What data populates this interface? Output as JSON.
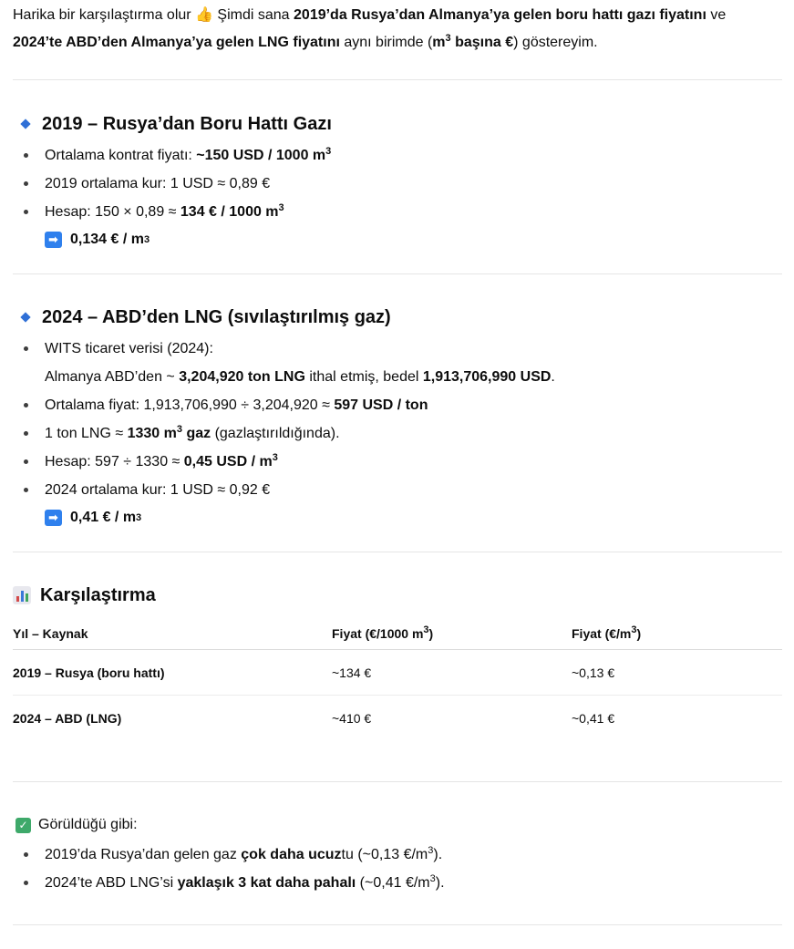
{
  "intro": {
    "t1": "Harika bir karşılaştırma olur ",
    "emoji": "👍",
    "t2": " Şimdi sana ",
    "b1": "2019’da Rusya’dan Almanya’ya gelen boru hattı gazı fiyatını",
    "t3": " ve",
    "b2": "2024’te ABD’den Almanya’ya gelen LNG fiyatını",
    "t4": " aynı birimde (",
    "b3a": "m",
    "b3sup": "3",
    "b3b": " başına €",
    "t5": ") göstereyim."
  },
  "section1": {
    "title": "2019 – Rusya’dan Boru Hattı Gazı",
    "items": [
      {
        "text": "Ortalama kontrat fiyatı: ",
        "bold": "~150 USD / 1000 m",
        "sup": "3"
      },
      {
        "text": "2019 ortalama kur: 1 USD ≈ 0,89 €"
      },
      {
        "text": "Hesap: 150 × 0,89 ≈ ",
        "bold": "134 € / 1000 m",
        "sup": "3"
      }
    ],
    "result": {
      "text": "0,134 € / m",
      "sup": "3"
    }
  },
  "section2": {
    "title": "2024 – ABD’den LNG (sıvılaştırılmış gaz)",
    "i1": "WITS ticaret verisi (2024):",
    "i1b": {
      "t1": "Almanya ABD’den ~ ",
      "b1": "3,204,920 ton LNG",
      "t2": " ithal etmiş, bedel ",
      "b2": "1,913,706,990 USD",
      "t3": "."
    },
    "i2": {
      "t1": "Ortalama fiyat: 1,913,706,990 ÷ 3,204,920 ≈ ",
      "b1": "597 USD / ton"
    },
    "i3": {
      "t1": "1 ton LNG ≈ ",
      "b1": "1330 m",
      "sup": "3",
      "b2": " gaz",
      "t2": " (gazlaştırıldığında)."
    },
    "i4": {
      "t1": "Hesap: 597 ÷ 1330 ≈ ",
      "b1": "0,45 USD / m",
      "sup": "3"
    },
    "i5": "2024 ortalama kur: 1 USD ≈ 0,92 €",
    "result": {
      "text": "0,41 € / m",
      "sup": "3"
    }
  },
  "section3": {
    "title": "Karşılaştırma",
    "headers": {
      "c1": "Yıl – Kaynak",
      "c2": "Fiyat (€/1000 m",
      "c2sup": "3",
      "c2end": ")",
      "c3": "Fiyat (€/m",
      "c3sup": "3",
      "c3end": ")"
    },
    "rows": [
      {
        "c1": "2019 – Rusya (boru hattı)",
        "c2": "~134 €",
        "c3": "~0,13 €"
      },
      {
        "c1": "2024 – ABD (LNG)",
        "c2": "~410 €",
        "c3": "~0,41 €"
      }
    ]
  },
  "conclusion": {
    "heading": "Görüldüğü gibi:",
    "i1": {
      "t1": "2019’da Rusya’dan gelen gaz ",
      "b1": "çok daha ucuz",
      "t2": "tu (~0,13 €/m",
      "sup": "3",
      "t3": ")."
    },
    "i2": {
      "t1": "2024’te ABD LNG’si ",
      "b1": "yaklaşık 3 kat daha pahalı",
      "t2": " (~0,41 €/m",
      "sup": "3",
      "t3": ")."
    }
  },
  "colors": {
    "diamond": "#2f6fd6",
    "arrow": "#2f80ed",
    "check": "#3ea96a"
  }
}
